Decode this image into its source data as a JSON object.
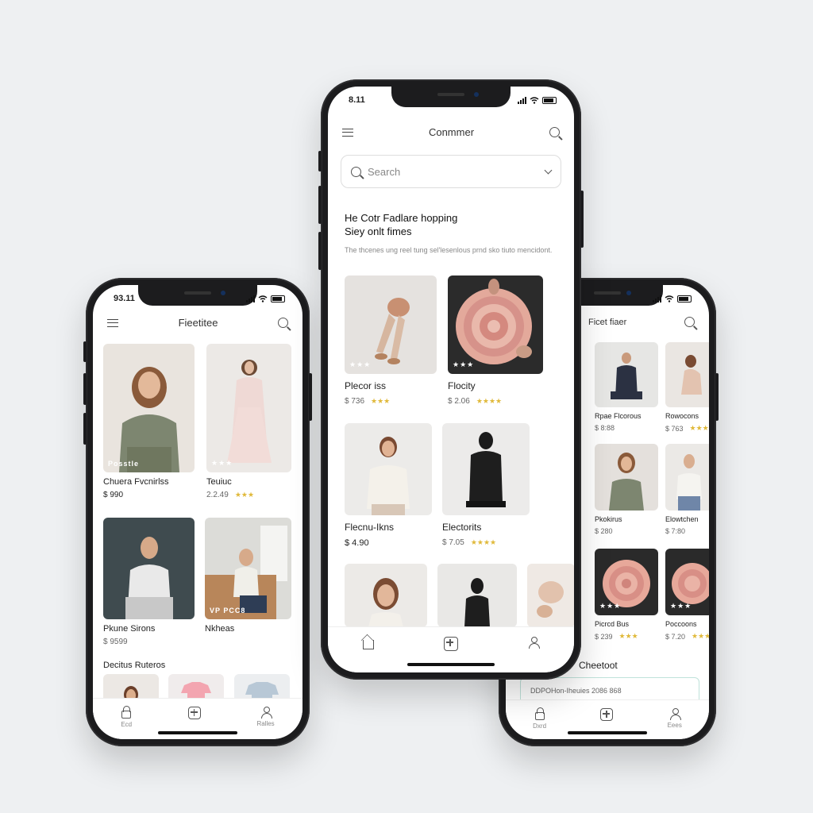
{
  "phones": {
    "left": {
      "time": "93.11",
      "title": "Fieetitee",
      "products": [
        {
          "name": "Chuera Fvcnirlss",
          "price": "$ 990",
          "badge": "Posstle"
        },
        {
          "name": "Teuiuc",
          "price": "2.2.49",
          "badge": "★★★"
        },
        {
          "name": "Pkune Sirons",
          "price": "$ 9599",
          "badge": ""
        },
        {
          "name": "Nkheas",
          "price": "",
          "badge": "VP PCC8"
        }
      ],
      "section_title": "Decitus Ruteros",
      "tabs": [
        "Ecd",
        "",
        "Ralles"
      ]
    },
    "center": {
      "time": "8.11",
      "title": "Conmmer",
      "search_placeholder": "Search",
      "headline_line1": "He Cotr Fadlare hopping",
      "headline_line2": "Siey onlt fimes",
      "description": "The thcenes ung reel tung sel'lesenlous prnd sko tiuto mencidont.",
      "products": [
        {
          "name": "Plecor iss",
          "price": "$ 736",
          "badge": "★★★"
        },
        {
          "name": "Flocity",
          "price": "$ 2.06",
          "badge": "★★★"
        },
        {
          "name": "Flecnu-Ikns",
          "price": "$ 4.90",
          "badge": ""
        },
        {
          "name": "Electorits",
          "price": "$ 7.05",
          "badge": ""
        }
      ]
    },
    "right": {
      "title": "Ficet fiaer",
      "products": [
        {
          "name": "Rpae Flcorous",
          "price": "$ 8:88",
          "badge": ""
        },
        {
          "name": "Rowocons",
          "price": "$ 763",
          "badge": ""
        },
        {
          "name": "Pkokirus",
          "price": "$ 280",
          "badge": ""
        },
        {
          "name": "Elowtchen",
          "price": "$ 7:80",
          "badge": ""
        },
        {
          "name": "Picrcd Bus",
          "price": "$ 239",
          "badge": "★★★"
        },
        {
          "name": "Poccoons",
          "price": "$ 7.20",
          "badge": "★★★"
        }
      ],
      "checkout_title": "Cheetoot",
      "checkout_field": "DDPOHon-Iheuies 2086 868",
      "tabs": [
        "Dxrd",
        "",
        "Eees"
      ]
    }
  },
  "stars": "★★★",
  "stars4": "★★★★",
  "colors": {
    "accent_star": "#e0b93a",
    "frame": "#1c1c1e",
    "background": "#eef0f2"
  }
}
